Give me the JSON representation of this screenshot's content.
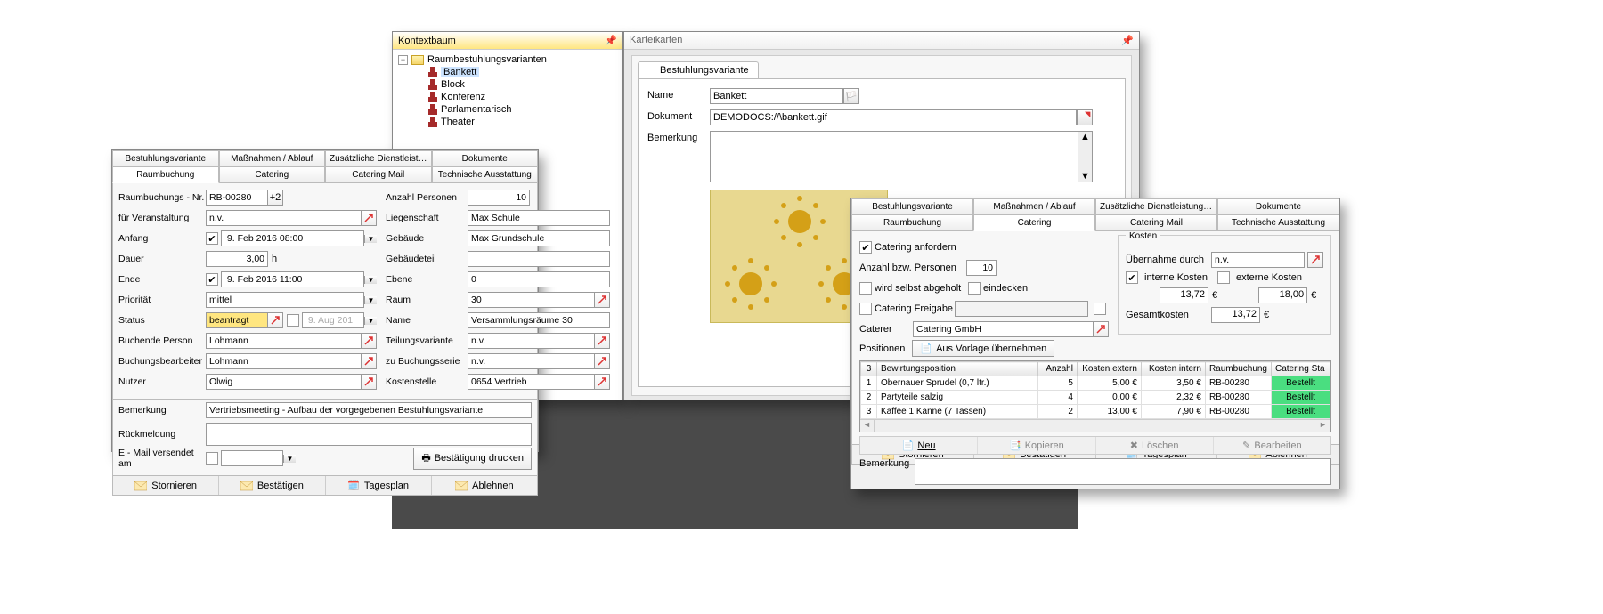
{
  "kontextbaum": {
    "title": "Kontextbaum",
    "root": "Raumbestuhlungsvarianten",
    "items": [
      "Bankett",
      "Block",
      "Konferenz",
      "Parlamentarisch",
      "Theater"
    ],
    "selected": "Bankett"
  },
  "karteikarten": {
    "title": "Karteikarten",
    "tab": "Bestuhlungsvariante",
    "labels": {
      "name": "Name",
      "dokument": "Dokument",
      "bemerkung": "Bemerkung"
    },
    "values": {
      "name": "Bankett",
      "dokument": "DEMODOCS://\\bankett.gif"
    }
  },
  "tabs_upper": [
    "Bestuhlungsvariante",
    "Maßnahmen / Ablauf",
    "Zusätzliche Dienstleistungen",
    "Dokumente"
  ],
  "tabs_lower": [
    "Raumbuchung",
    "Catering",
    "Catering Mail",
    "Technische Ausstattung"
  ],
  "raumbuchung": {
    "labels": {
      "nr": "Raumbuchungs - Nr.",
      "veranst": "für Veranstaltung",
      "anfang": "Anfang",
      "dauer": "Dauer",
      "ende": "Ende",
      "prio": "Priorität",
      "status": "Status",
      "buchper": "Buchende Person",
      "buchbea": "Buchungsbearbeiter",
      "nutzer": "Nutzer",
      "bemerk": "Bemerkung",
      "rueck": "Rückmeldung",
      "email": "E - Mail versendet am",
      "anzahl": "Anzahl Personen",
      "lieg": "Liegenschaft",
      "gebaeude": "Gebäude",
      "gebteil": "Gebäudeteil",
      "ebene": "Ebene",
      "raum": "Raum",
      "name": "Name",
      "teilungsvar": "Teilungsvariante",
      "serie": "zu Buchungsserie",
      "kostenstelle": "Kostenstelle",
      "h": "h",
      "bestaetigung": "Bestätigung drucken"
    },
    "values": {
      "nr": "RB-00280",
      "veranst": "n.v.",
      "anfang": " 9. Feb 2016 08:00",
      "dauer": "3,00",
      "ende": " 9. Feb 2016 11:00",
      "prio": "mittel",
      "status": "beantragt",
      "statusdate": " 9. Aug 201",
      "buchper": "Lohmann",
      "buchbea": "Lohmann",
      "nutzer": "Olwig",
      "bemerk": "Vertriebsmeeting - Aufbau der vorgegebenen Bestuhlungsvariante",
      "anzahl": "10",
      "lieg": "Max Schule",
      "gebaeude": "Max Grundschule",
      "ebene": "0",
      "raum": "30",
      "name": "Versammlungsräume 30",
      "teilungsvar": "n.v.",
      "serie": "n.v.",
      "kostenstelle": "0654 Vertrieb"
    },
    "buttons": {
      "storn": "Stornieren",
      "best": "Bestätigen",
      "tages": "Tagesplan",
      "abl": "Ablehnen"
    }
  },
  "catering": {
    "labels": {
      "anfordern": "Catering anfordern",
      "anzahl": "Anzahl bzw. Personen",
      "abgeholt": "wird selbst abgeholt",
      "eindecken": "eindecken",
      "freigabe": "Catering Freigabe",
      "caterer": "Caterer",
      "positionen": "Positionen",
      "vorlage": "Aus Vorlage übernehmen",
      "kosten": "Kosten",
      "uebernahme": "Übernahme durch",
      "interne": "interne Kosten",
      "externe": "externe Kosten",
      "gesamt": "Gesamtkosten",
      "bemerkung": "Bemerkung"
    },
    "values": {
      "anzahl": "10",
      "caterer": "Catering GmbH",
      "uebernahme": "n.v.",
      "interne": "13,72",
      "externe": "18,00",
      "gesamt": "13,72"
    },
    "cols": [
      "3",
      "Bewirtungsposition",
      "Anzahl",
      "Kosten extern",
      "Kosten intern",
      "Raumbuchung",
      "Catering Sta"
    ],
    "rows": [
      {
        "n": "1",
        "pos": "Obernauer Sprudel (0,7 ltr.)",
        "anz": "5",
        "ext": "5,00 €",
        "int": "3,50 €",
        "rb": "RB-00280",
        "st": "Bestellt"
      },
      {
        "n": "2",
        "pos": "Partyteile salzig",
        "anz": "4",
        "ext": "0,00 €",
        "int": "2,32 €",
        "rb": "RB-00280",
        "st": "Bestellt"
      },
      {
        "n": "3",
        "pos": "Kaffee 1 Kanne (7 Tassen)",
        "anz": "2",
        "ext": "13,00 €",
        "int": "7,90 €",
        "rb": "RB-00280",
        "st": "Bestellt"
      }
    ],
    "toolbar": {
      "neu": "Neu",
      "kop": "Kopieren",
      "loe": "Löschen",
      "bea": "Bearbeiten"
    }
  }
}
